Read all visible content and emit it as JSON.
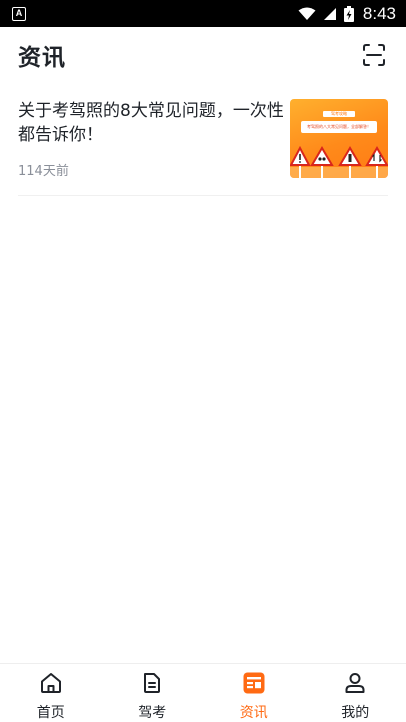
{
  "status_bar": {
    "app_icon_letter": "A",
    "time": "8:43"
  },
  "header": {
    "title": "资讯"
  },
  "news": [
    {
      "title": "关于考驾照的8大常见问题，一次性都告诉你！",
      "meta": "114天前",
      "thumbnail": {
        "tag": "驾考攻略",
        "banner": "考驾照的八大常见问题，全部解答！"
      }
    }
  ],
  "bottom_nav": [
    {
      "label": "首页",
      "icon": "home-icon",
      "active": false
    },
    {
      "label": "驾考",
      "icon": "document-icon",
      "active": false
    },
    {
      "label": "资讯",
      "icon": "news-icon",
      "active": true
    },
    {
      "label": "我的",
      "icon": "user-icon",
      "active": false
    }
  ],
  "colors": {
    "accent": "#ff6a13",
    "text": "#1f2329",
    "muted": "#8a8f99"
  }
}
